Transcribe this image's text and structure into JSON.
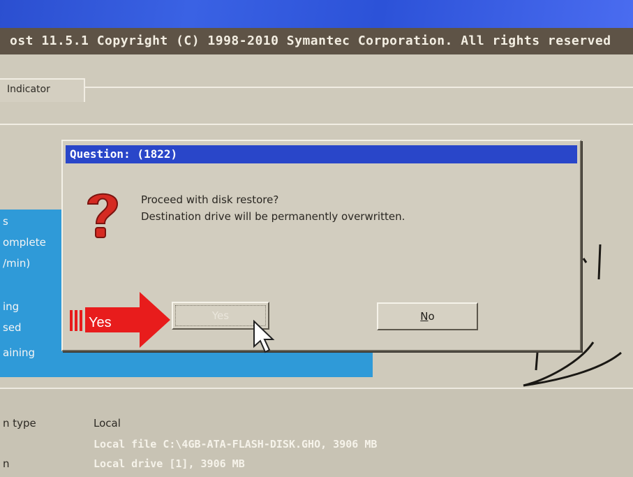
{
  "header": {
    "copyright": "ost 11.5.1   Copyright (C) 1998-2010 Symantec Corporation. All rights reserved"
  },
  "tab": {
    "label": "Indicator"
  },
  "progress_panel": {
    "labels": [
      "s",
      "omplete",
      "/min)",
      "ing",
      "sed",
      "aining"
    ]
  },
  "details": {
    "type_label": "n type",
    "type_value": "Local",
    "source_value": "Local file C:\\4GB-ATA-FLASH-DISK.GHO, 3906 MB",
    "dest_label": "n",
    "dest_value": "Local drive [1], 3906 MB"
  },
  "dialog": {
    "title": "Question: (1822)",
    "message_line1": "Proceed with disk restore?",
    "message_line2": "Destination drive will be permanently overwritten.",
    "yes_label": "Yes",
    "no_label_prefix": "N",
    "no_label_suffix": "o",
    "icon": "question-mark-icon"
  },
  "annotation": {
    "arrow_label": "Yes",
    "color": "#e81c1c"
  },
  "colors": {
    "title_bar": "#2946c9",
    "progress_panel": "#2f9ad8",
    "banner": "#3a62e4"
  }
}
